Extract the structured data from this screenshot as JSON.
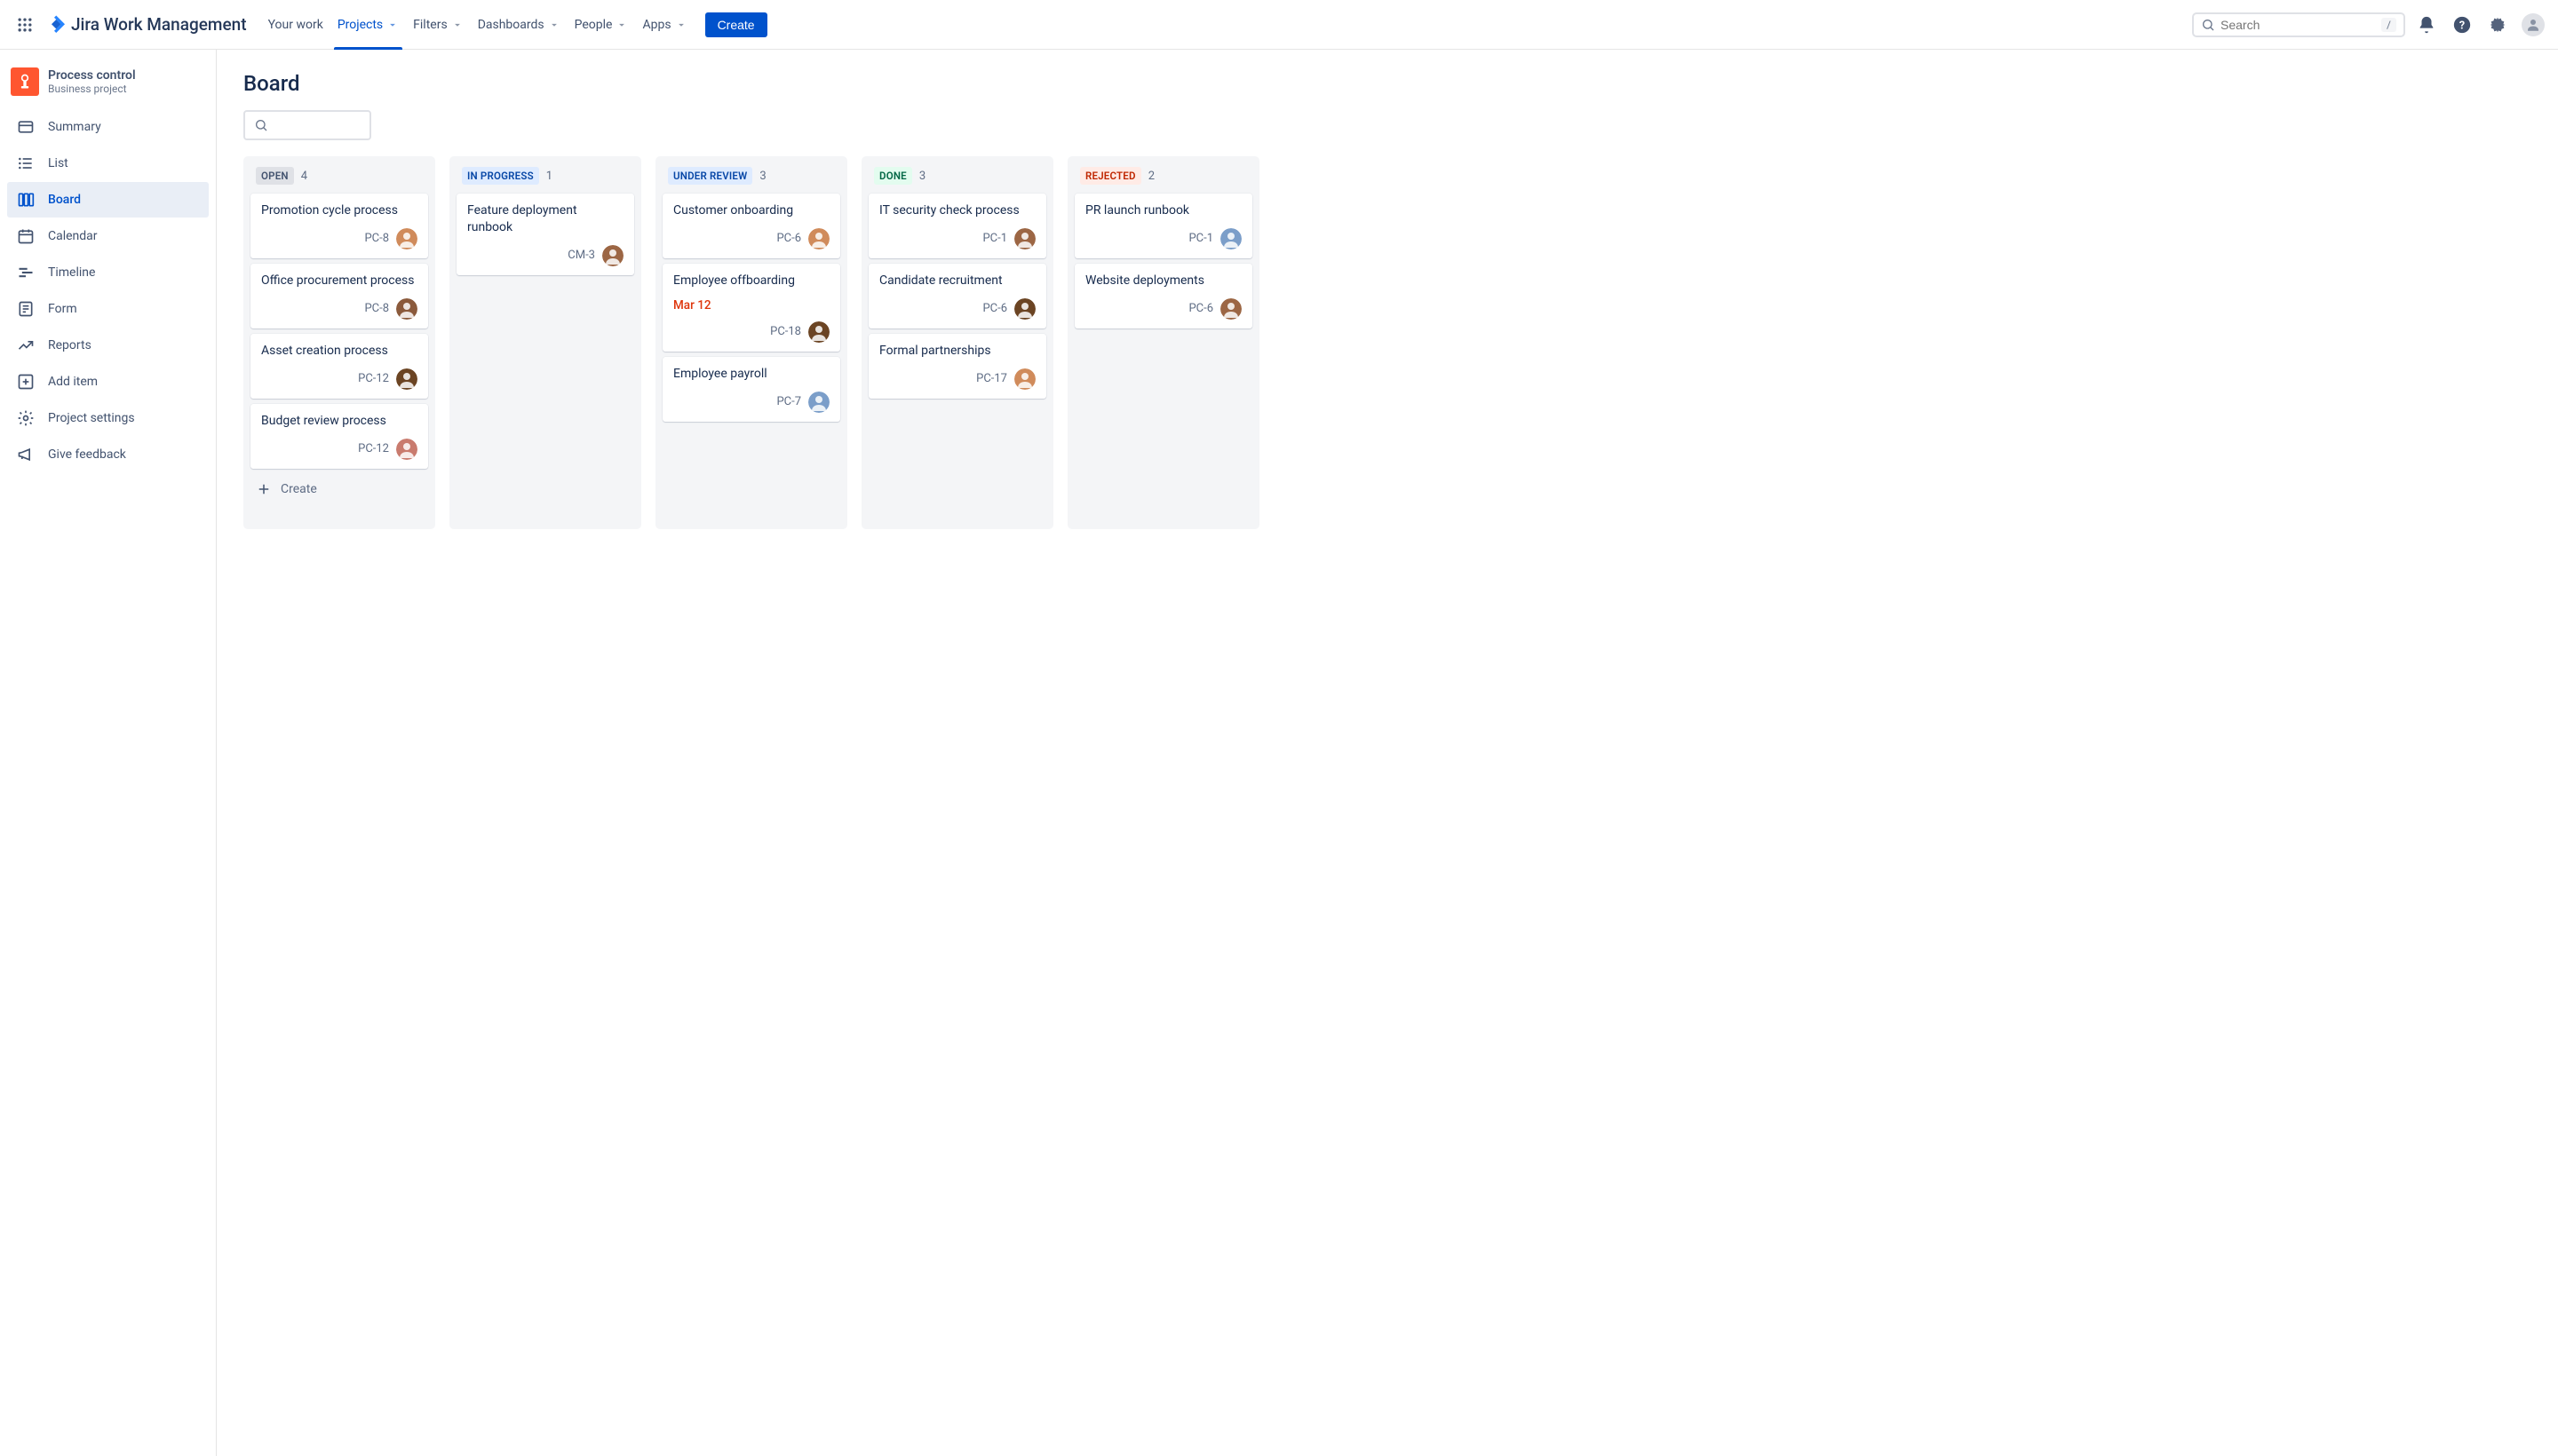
{
  "header": {
    "product_name": "Jira Work Management",
    "nav": [
      "Your work",
      "Projects",
      "Filters",
      "Dashboards",
      "People",
      "Apps"
    ],
    "active_nav_index": 1,
    "nav_has_dropdown": [
      false,
      true,
      true,
      true,
      true,
      true
    ],
    "create_label": "Create",
    "search_placeholder": "Search",
    "search_kbd": "/"
  },
  "sidebar": {
    "project_name": "Process control",
    "project_type": "Business project",
    "items": [
      {
        "label": "Summary",
        "icon": "card-icon"
      },
      {
        "label": "List",
        "icon": "list-icon"
      },
      {
        "label": "Board",
        "icon": "board-icon",
        "active": true
      },
      {
        "label": "Calendar",
        "icon": "calendar-icon"
      },
      {
        "label": "Timeline",
        "icon": "timeline-icon"
      },
      {
        "label": "Form",
        "icon": "form-icon"
      },
      {
        "label": "Reports",
        "icon": "reports-icon"
      },
      {
        "label": "Add item",
        "icon": "add-item-icon"
      },
      {
        "label": "Project settings",
        "icon": "gear-icon"
      },
      {
        "label": "Give feedback",
        "icon": "megaphone-icon"
      }
    ]
  },
  "main": {
    "title": "Board",
    "create_label": "Create",
    "columns": [
      {
        "title": "OPEN",
        "count": 4,
        "bg": "#dfe1e6",
        "fg": "#42526E",
        "show_create": true,
        "cards": [
          {
            "title": "Promotion cycle process",
            "key": "PC-8",
            "avatar": "a1"
          },
          {
            "title": "Office procurement process",
            "key": "PC-8",
            "avatar": "a2"
          },
          {
            "title": "Asset creation process",
            "key": "PC-12",
            "avatar": "a3"
          },
          {
            "title": "Budget review process",
            "key": "PC-12",
            "avatar": "a4"
          }
        ]
      },
      {
        "title": "IN PROGRESS",
        "count": 1,
        "bg": "#DEEBFF",
        "fg": "#0747A6",
        "cards": [
          {
            "title": "Feature deployment runbook",
            "key": "CM-3",
            "avatar": "a5"
          }
        ]
      },
      {
        "title": "UNDER REVIEW",
        "count": 3,
        "bg": "#DEEBFF",
        "fg": "#0747A6",
        "cards": [
          {
            "title": "Customer onboarding",
            "key": "PC-6",
            "avatar": "a1"
          },
          {
            "title": "Employee offboarding",
            "date": "Mar 12",
            "key": "PC-18",
            "avatar": "a3"
          },
          {
            "title": "Employee payroll",
            "key": "PC-7",
            "avatar": "a6"
          }
        ]
      },
      {
        "title": "DONE",
        "count": 3,
        "bg": "#E3FCEF",
        "fg": "#006644",
        "cards": [
          {
            "title": "IT security check process",
            "key": "PC-1",
            "avatar": "a5"
          },
          {
            "title": "Candidate recruitment",
            "key": "PC-6",
            "avatar": "a3"
          },
          {
            "title": "Formal partnerships",
            "key": "PC-17",
            "avatar": "a1"
          }
        ]
      },
      {
        "title": "REJECTED",
        "count": 2,
        "bg": "#FFEBE6",
        "fg": "#BF2600",
        "cards": [
          {
            "title": "PR launch runbook",
            "key": "PC-1",
            "avatar": "a6"
          },
          {
            "title": "Website deployments",
            "key": "PC-6",
            "avatar": "a5"
          }
        ]
      }
    ]
  },
  "avatars": {
    "a1": "#d08b5b",
    "a2": "#8b5a3c",
    "a3": "#6b4423",
    "a4": "#c97b6e",
    "a5": "#9c6644",
    "a6": "#7b9ec9"
  }
}
